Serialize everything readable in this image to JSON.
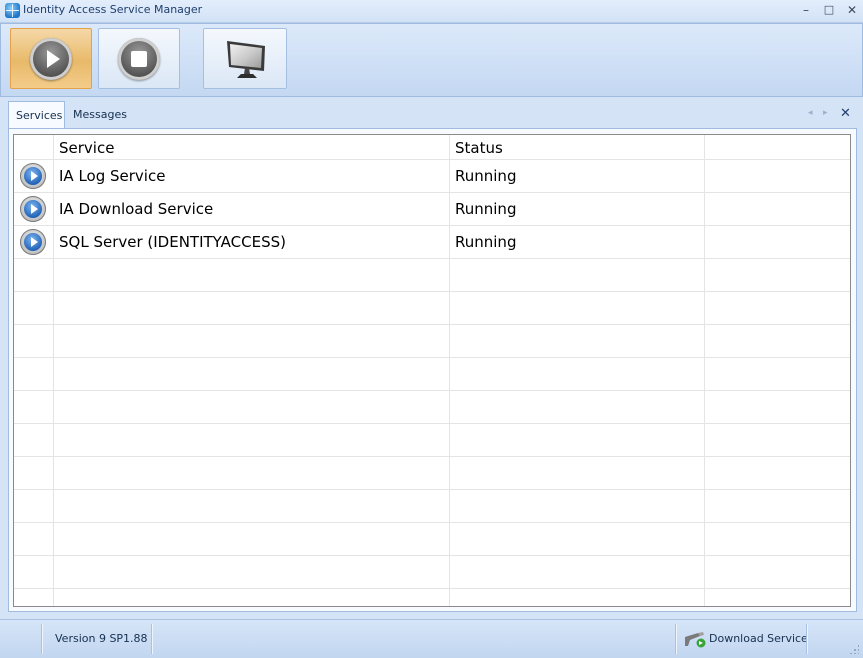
{
  "window": {
    "title": "Identity Access Service Manager",
    "minimize": "–",
    "maximize": "□",
    "close": "✕"
  },
  "toolbar": {
    "buttons": [
      {
        "name": "start-service-button",
        "icon": "play-icon",
        "active": true
      },
      {
        "name": "stop-service-button",
        "icon": "stop-icon",
        "active": false
      },
      {
        "name": "monitor-button",
        "icon": "monitor-icon",
        "active": false
      }
    ]
  },
  "tabs": [
    {
      "label": "Services",
      "selected": true
    },
    {
      "label": "Messages",
      "selected": false
    }
  ],
  "tab_nav": {
    "prev": "◂",
    "next": "▸",
    "close": "✕"
  },
  "grid": {
    "columns": [
      "Service",
      "Status"
    ],
    "rows": [
      {
        "service": "IA Log Service",
        "status": "Running",
        "icon": "running-service-icon"
      },
      {
        "service": "IA Download Service",
        "status": "Running",
        "icon": "running-service-icon"
      },
      {
        "service": "SQL Server (IDENTITYACCESS)",
        "status": "Running",
        "icon": "running-service-icon"
      }
    ]
  },
  "statusbar": {
    "version": "Version 9 SP1.88",
    "service": "Download Service",
    "service_icon": "download-service-icon"
  },
  "colors": {
    "active_button": "#e8b96a",
    "chrome": "#d4e3f6",
    "row_icon": "#1d5fb5"
  }
}
